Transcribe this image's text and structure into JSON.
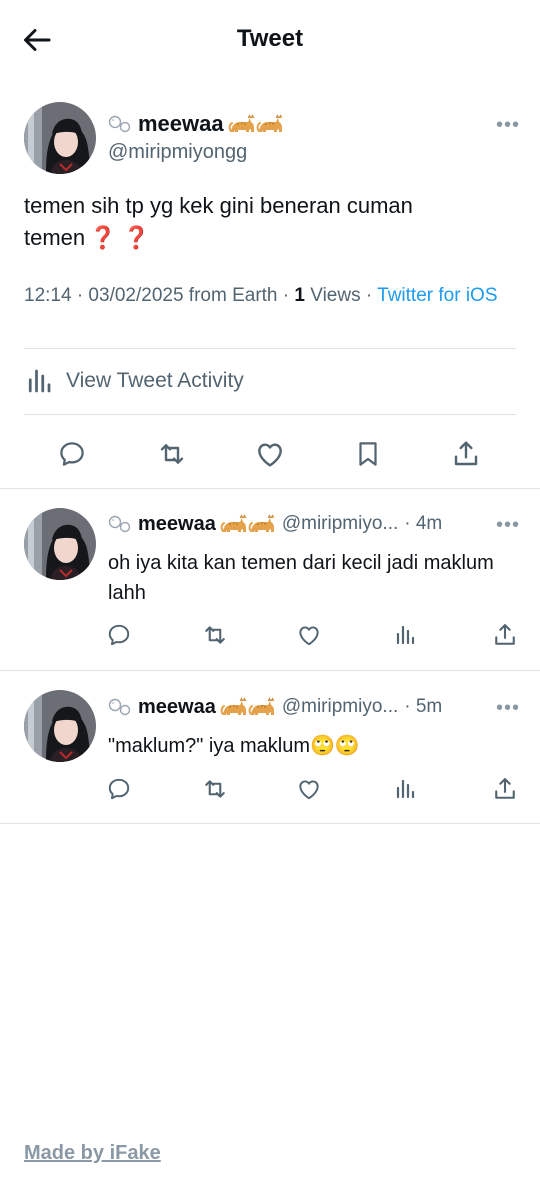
{
  "header": {
    "title": "Tweet"
  },
  "tweet": {
    "name": "meewaa",
    "handle": "@miripmiyongg",
    "text": "temen sih tp yg kek gini beneran cuman temen",
    "text_emoji": "❓ ❓",
    "time": "12:14 · 03/02/2025 from Earth · ",
    "views_count": "1",
    "views_label": " Views · ",
    "source": "Twitter for iOS",
    "activity_label": "View Tweet Activity",
    "more": "•••"
  },
  "replies": [
    {
      "name": "meewaa",
      "handle": "@miripmiyo...",
      "time": "· 4m",
      "text": "oh iya kita kan temen dari kecil jadi maklum lahh",
      "more": "•••"
    },
    {
      "name": "meewaa",
      "handle": "@miripmiyo...",
      "time": "· 5m",
      "text": "\"maklum?\" iya maklum🙄🙄",
      "more": "•••"
    }
  ],
  "footer": {
    "label": "Made by iFake"
  },
  "colors": {
    "accent": "#1d9bf0",
    "text": "#0f1419",
    "secondary": "#536471",
    "divider": "#dfe3e6",
    "question": "#d4161c"
  }
}
